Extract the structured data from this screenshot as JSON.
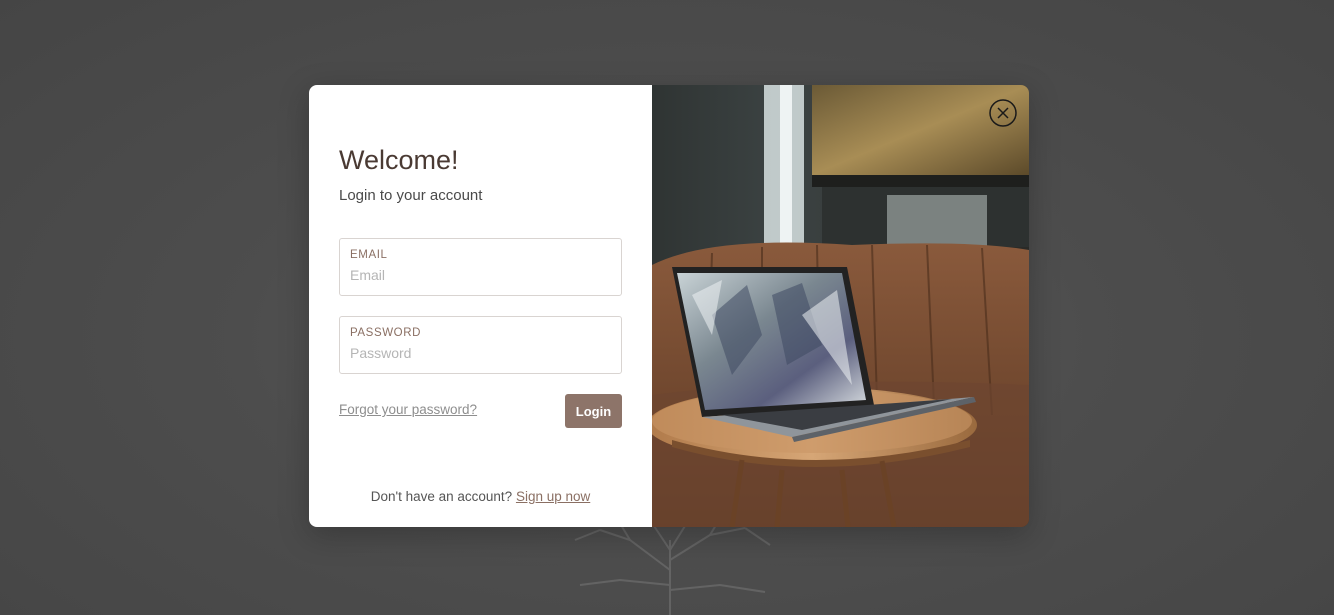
{
  "login": {
    "title": "Welcome!",
    "subtitle": "Login to your account",
    "email": {
      "label": "EMAIL",
      "placeholder": "Email",
      "value": ""
    },
    "password": {
      "label": "PASSWORD",
      "placeholder": "Password",
      "value": ""
    },
    "forgot_label": "Forgot your password?",
    "submit_label": "Login",
    "signup_prompt": "Don't have an account?",
    "signup_link": "Sign up now"
  },
  "icons": {
    "close": "close-icon"
  },
  "colors": {
    "accent": "#8d7469",
    "title": "#4a3a33",
    "overlay": "#4d4d4d"
  }
}
